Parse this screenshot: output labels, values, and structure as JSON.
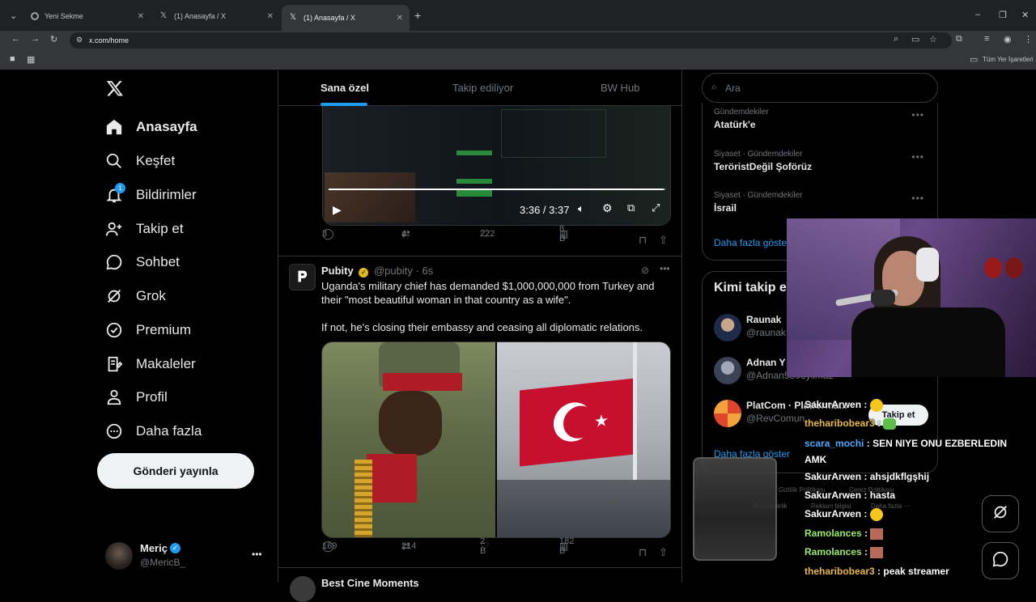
{
  "browser": {
    "tabs": [
      {
        "title": "Yeni Sekme",
        "active": false
      },
      {
        "title": "(1) Anasayfa / X",
        "active": false
      },
      {
        "title": "(1) Anasayfa / X",
        "active": true
      }
    ],
    "url": "x.com/home",
    "bookmarks_label": "Tüm Yer İşaretleri"
  },
  "sidebar": {
    "items": [
      {
        "label": "Anasayfa",
        "icon": "home-icon"
      },
      {
        "label": "Keşfet",
        "icon": "search-icon"
      },
      {
        "label": "Bildirimler",
        "icon": "bell-icon",
        "badge": "1"
      },
      {
        "label": "Takip et",
        "icon": "follow-icon"
      },
      {
        "label": "Sohbet",
        "icon": "chat-icon"
      },
      {
        "label": "Grok",
        "icon": "grok-icon"
      },
      {
        "label": "Premium",
        "icon": "verified-icon"
      },
      {
        "label": "Makaleler",
        "icon": "articles-icon"
      },
      {
        "label": "Profil",
        "icon": "profile-icon"
      },
      {
        "label": "Daha fazla",
        "icon": "more-icon"
      }
    ],
    "post_button": "Gönderi yayınla",
    "account": {
      "name": "Meriç",
      "handle": "@MericB_"
    }
  },
  "timeline": {
    "tabs": [
      {
        "label": "Sana özel",
        "selected": true
      },
      {
        "label": "Takip ediliyor",
        "selected": false
      },
      {
        "label": "BW Hub",
        "selected": false
      }
    ],
    "video": {
      "time": "3:36 / 3:37",
      "progress": 0.995
    },
    "video_actions": {
      "replies": "3",
      "retweets": "4",
      "likes": "222",
      "views": "8 B"
    },
    "tweet": {
      "name": "Pubity",
      "handle": "@pubity",
      "time": "6s",
      "text1": "Uganda's military chief has demanded $1,000,000,000 from Turkey and their \"most beautiful woman in that country as a wife\".",
      "text2": "If not, he's closing their embassy and ceasing all diplomatic relations.",
      "actions": {
        "replies": "169",
        "retweets": "214",
        "likes": "2 B",
        "views": "182 B"
      }
    },
    "next_tweet_partial": "Best Cine Moments"
  },
  "right": {
    "search_placeholder": "Ara",
    "trends": [
      {
        "context": "Gündemdekiler",
        "name": "Atatürk'e"
      },
      {
        "context": "Siyaset · Gündemdekiler",
        "name": "TeröristDeğil Şoförüz"
      },
      {
        "context": "Siyaset · Gündemdekiler",
        "name": "İsrail"
      }
    ],
    "trends_more": "Daha fazla göster",
    "who_title": "Kimi takip et",
    "who": [
      {
        "name": "Raunak",
        "handle": "@raunak"
      },
      {
        "name": "Adnan Y",
        "handle": "@Adnan5806yilmaz"
      },
      {
        "name": "PlatCom · Platforma...",
        "handle": "@RevComun"
      }
    ],
    "follow_label": "Takip et",
    "who_more": "Daha fazla göster",
    "footer": [
      "Gizlilik Politikası",
      "Çerez Politikası",
      "Erişilebilirlik",
      "Reklam bilgisi",
      "Daha fazla ···"
    ]
  },
  "stream_chat": [
    {
      "user": "SakurArwen",
      "msg": "",
      "color": "#ffffff",
      "emote": "grin"
    },
    {
      "user": "theharibobear3",
      "msg": "",
      "color": "#e8b84a",
      "emote": "frog"
    },
    {
      "user": "scara_mochi",
      "msg": "SEN NIYE ONU EZBERLEDIN AMK",
      "color": "#4fa8ff"
    },
    {
      "user": "SakurArwen",
      "msg": "ahsjdkflgşhij",
      "color": "#ffffff"
    },
    {
      "user": "SakurArwen",
      "msg": "hasta",
      "color": "#ffffff"
    },
    {
      "user": "SakurArwen",
      "msg": "",
      "color": "#ffffff",
      "emote": "cold"
    },
    {
      "user": "Ramolances",
      "msg": "",
      "color": "#9be86a",
      "emote": "face"
    },
    {
      "user": "Ramolances",
      "msg": "",
      "color": "#9be86a",
      "emote": "face"
    },
    {
      "user": "theharibobear3",
      "msg": "peak streamer",
      "color": "#e8b84a"
    }
  ],
  "colors": {
    "accent": "#1d9bf0",
    "bg": "#000000",
    "border": "#2f3336",
    "muted": "#71767b"
  }
}
